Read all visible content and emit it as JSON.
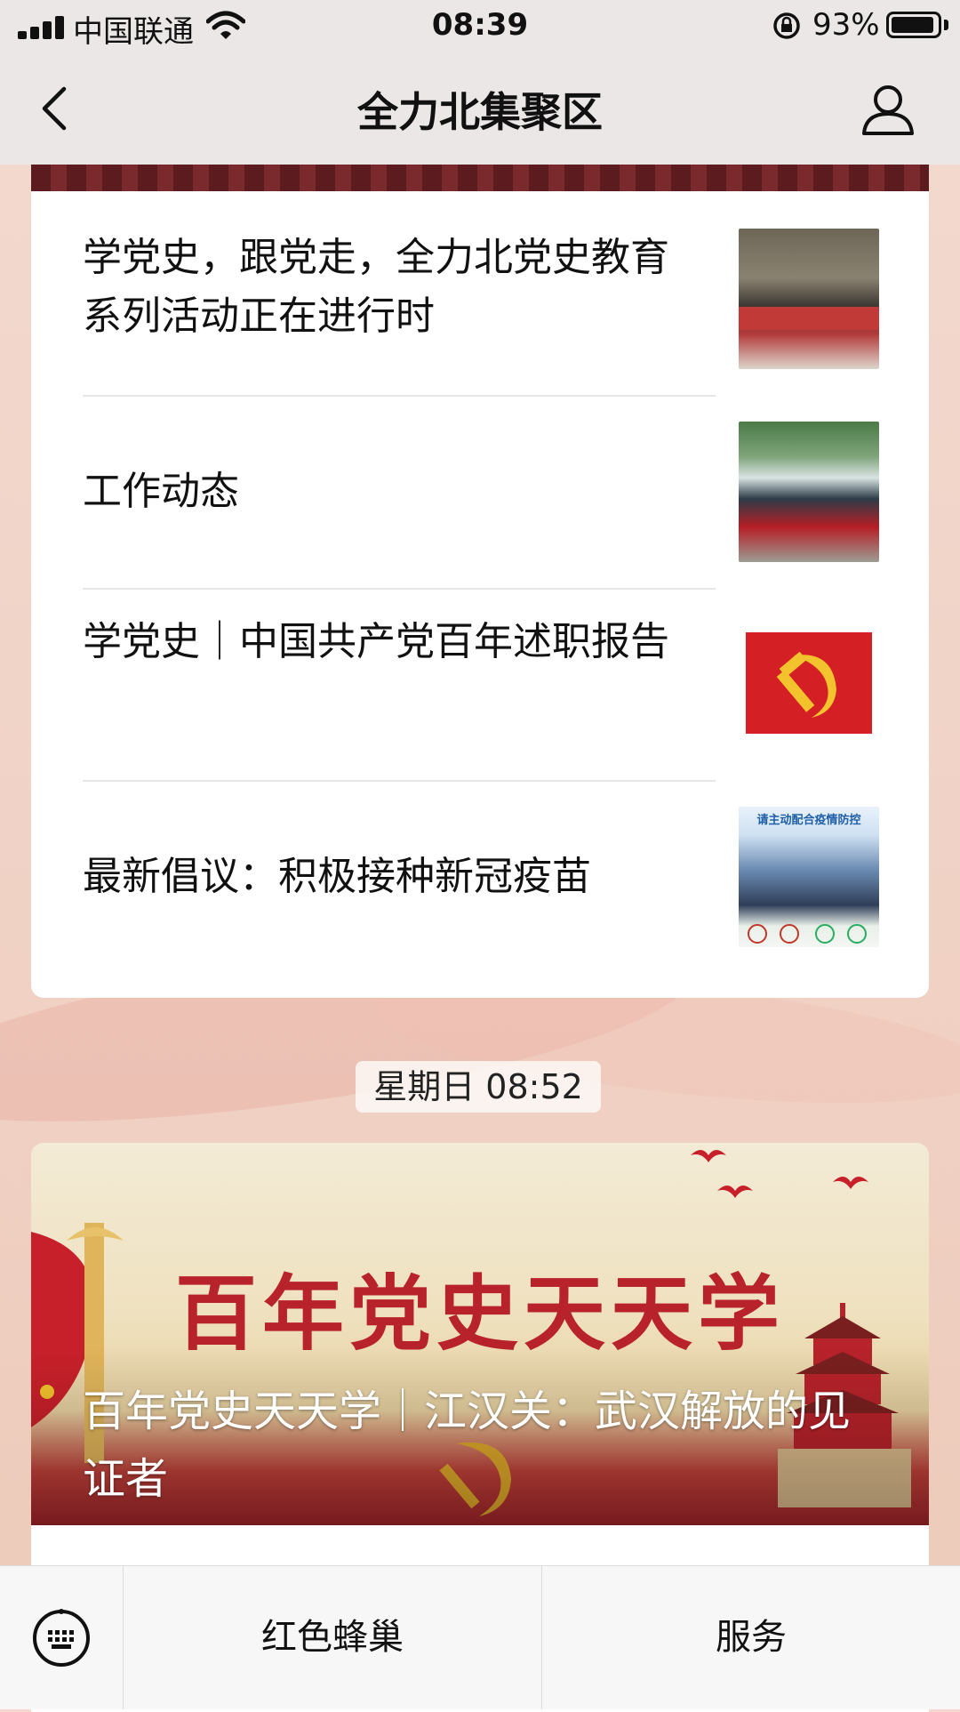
{
  "status_bar": {
    "carrier": "中国联通",
    "time": "08:39",
    "battery_percent": "93%",
    "battery_level": 0.93
  },
  "nav": {
    "title": "全力北集聚区",
    "back_icon": "chevron-left-icon",
    "profile_icon": "user-icon"
  },
  "articles": [
    {
      "title": "学党史，跟党走，全力北党史教育系列活动正在进行时",
      "thumbnail": "exhibition-hall-photo"
    },
    {
      "title": "工作动态",
      "thumbnail": "volunteers-tent-photo"
    },
    {
      "title": "学党史｜中国共产党百年述职报告",
      "thumbnail": "party-emblem-image"
    },
    {
      "title": "最新倡议：积极接种新冠疫苗",
      "thumbnail": "epidemic-prevention-poster",
      "thumbnail_text": "请主动配合疫情防控"
    }
  ],
  "timestamp": "星期日 08:52",
  "banner": {
    "headline": "百年党史天天学",
    "caption": "百年党史天天学｜江汉关：武汉解放的见证者"
  },
  "menu": {
    "keyboard_icon": "keyboard-icon",
    "items": [
      "红色蜂巢",
      "服务"
    ]
  },
  "colors": {
    "party_red": "#c8202a",
    "background": "#f1d4c8"
  }
}
